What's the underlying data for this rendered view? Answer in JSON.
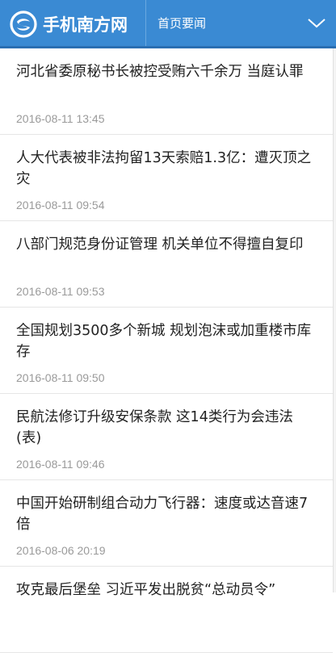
{
  "header": {
    "brand": "手机南方网",
    "section": "首页要闻",
    "accent_color": "#3a8ad3",
    "menu_icon": "chevron-down-icon",
    "logo_icon": "nanfang-logo-icon"
  },
  "news": [
    {
      "title": "河北省委原秘书长被控受贿六千余万 当庭认罪",
      "time": "2016-08-11 13:45"
    },
    {
      "title": "人大代表被非法拘留13天索赔1.3亿：遭灭顶之灾",
      "time": "2016-08-11 09:54"
    },
    {
      "title": "八部门规范身份证管理 机关单位不得擅自复印",
      "time": "2016-08-11 09:53"
    },
    {
      "title": "全国规划3500多个新城 规划泡沫或加重楼市库存",
      "time": "2016-08-11 09:50"
    },
    {
      "title": "民航法修订升级安保条款 这14类行为会违法(表)",
      "time": "2016-08-11 09:46"
    },
    {
      "title": "中国开始研制组合动力飞行器：速度或达音速7倍",
      "time": "2016-08-06 20:19"
    },
    {
      "title": "攻克最后堡垒 习近平发出脱贫“总动员令”",
      "time": ""
    }
  ]
}
